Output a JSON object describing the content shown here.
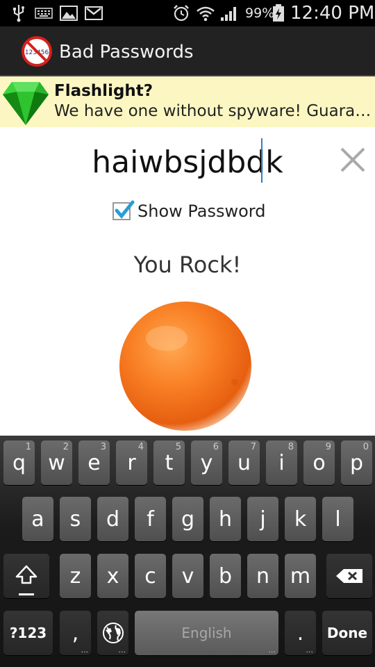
{
  "status_bar": {
    "battery": "99%",
    "time": "12:40 PM",
    "icons": [
      "usb-icon",
      "keyboard-icon",
      "image-icon",
      "gmail-icon",
      "alarm-icon",
      "wifi-icon",
      "signal-icon",
      "battery-charging-icon"
    ]
  },
  "app": {
    "title": "Bad Passwords",
    "logo_text": "123456"
  },
  "ad": {
    "title": "Flashlight?",
    "body": "We have one without spyware! Guaranteed!"
  },
  "password": {
    "value": "haiwbsjdbdk"
  },
  "show_password": {
    "label": "Show Password",
    "checked": true
  },
  "result": {
    "message": "You Rock!"
  },
  "keyboard": {
    "row1": [
      {
        "label": "q",
        "num": "1"
      },
      {
        "label": "w",
        "num": "2"
      },
      {
        "label": "e",
        "num": "3"
      },
      {
        "label": "r",
        "num": "4"
      },
      {
        "label": "t",
        "num": "5"
      },
      {
        "label": "y",
        "num": "6"
      },
      {
        "label": "u",
        "num": "7"
      },
      {
        "label": "i",
        "num": "8"
      },
      {
        "label": "o",
        "num": "9"
      },
      {
        "label": "p",
        "num": "0"
      }
    ],
    "row2": [
      "a",
      "s",
      "d",
      "f",
      "g",
      "h",
      "j",
      "k",
      "l"
    ],
    "row3": [
      "z",
      "x",
      "c",
      "v",
      "b",
      "n",
      "m"
    ],
    "symbols_label": "?123",
    "comma_label": ",",
    "space_label": "English",
    "period_label": ".",
    "done_label": "Done"
  }
}
